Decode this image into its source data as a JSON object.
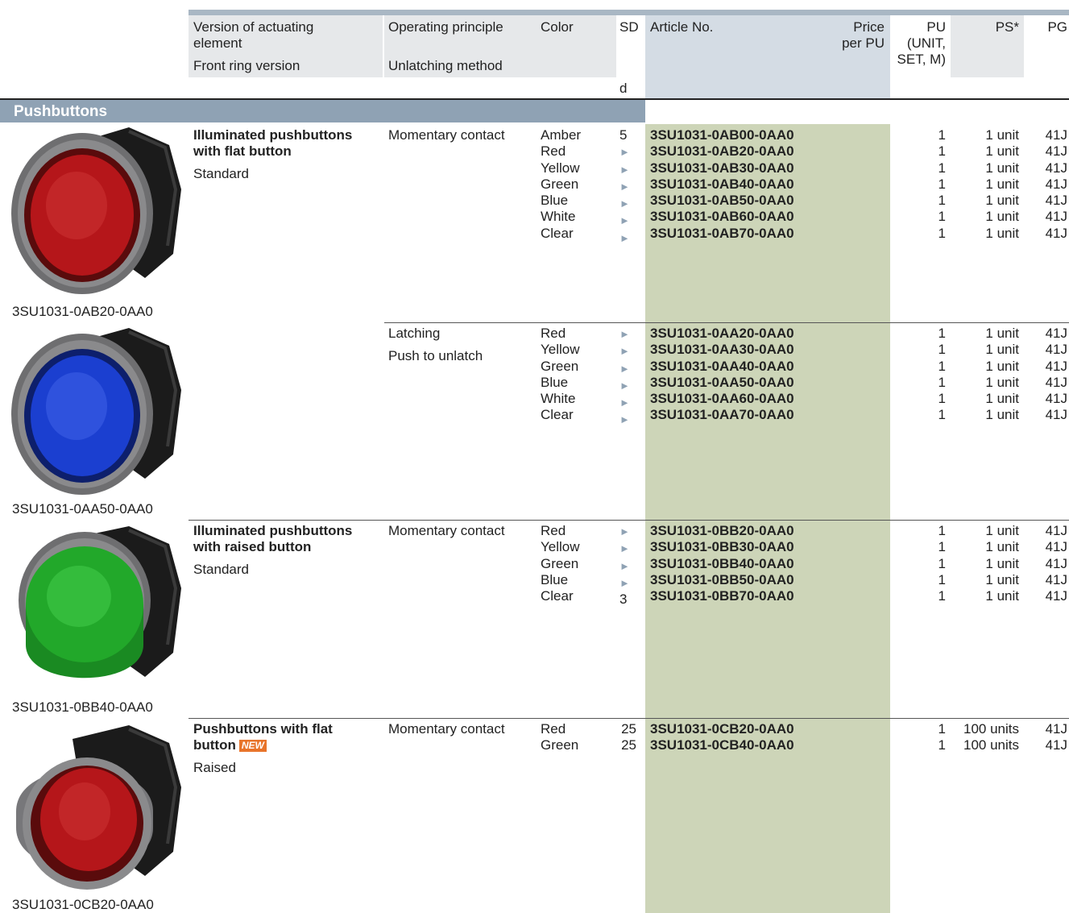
{
  "header": {
    "version": "Version of actuating element",
    "front_ring": "Front ring version",
    "principle": "Operating principle",
    "unlatching": "Unlatching method",
    "color": "Color",
    "sd": "SD",
    "sd_unit": "d",
    "article": "Article No.",
    "price": "Price per PU",
    "pu": "PU (UNIT, SET, M)",
    "ps": "PS*",
    "pg": "PG"
  },
  "section_title": "Pushbuttons",
  "groups": [
    {
      "image_caption": "3SU1031-0AB20-0AA0",
      "version": "Illuminated pushbuttons with flat button",
      "is_new": false,
      "front_ring": "Standard",
      "principle": "Momentary contact",
      "unlatch": "",
      "colors": "Amber\nRed\nYellow\nGreen\nBlue\nWhite\nClear",
      "sd": "5\n►\n►\n►\n►\n►\n►",
      "articles": "3SU1031-0AB00-0AA0\n3SU1031-0AB20-0AA0\n3SU1031-0AB30-0AA0\n3SU1031-0AB40-0AA0\n3SU1031-0AB50-0AA0\n3SU1031-0AB60-0AA0\n3SU1031-0AB70-0AA0",
      "pu": "1\n1\n1\n1\n1\n1\n1",
      "ps": "1 unit\n1 unit\n1 unit\n1 unit\n1 unit\n1 unit\n1 unit",
      "pg": "41J\n41J\n41J\n41J\n41J\n41J\n41J"
    },
    {
      "image_caption": "3SU1031-0AA50-0AA0",
      "version": "",
      "is_new": false,
      "front_ring": "",
      "principle": "Latching",
      "unlatch": "Push to unlatch",
      "colors": "Red\nYellow\nGreen\nBlue\nWhite\nClear",
      "sd": "►\n►\n►\n►\n►\n►",
      "articles": "3SU1031-0AA20-0AA0\n3SU1031-0AA30-0AA0\n3SU1031-0AA40-0AA0\n3SU1031-0AA50-0AA0\n3SU1031-0AA60-0AA0\n3SU1031-0AA70-0AA0",
      "pu": "1\n1\n1\n1\n1\n1",
      "ps": "1 unit\n1 unit\n1 unit\n1 unit\n1 unit\n1 unit",
      "pg": "41J\n41J\n41J\n41J\n41J\n41J"
    },
    {
      "image_caption": "3SU1031-0BB40-0AA0",
      "version": "Illuminated pushbuttons with raised button",
      "is_new": false,
      "front_ring": "Standard",
      "principle": "Momentary contact",
      "unlatch": "",
      "colors": "Red\nYellow\nGreen\nBlue\nClear",
      "sd": "►\n►\n►\n►\n3",
      "articles": "3SU1031-0BB20-0AA0\n3SU1031-0BB30-0AA0\n3SU1031-0BB40-0AA0\n3SU1031-0BB50-0AA0\n3SU1031-0BB70-0AA0",
      "pu": "1\n1\n1\n1\n1",
      "ps": "1 unit\n1 unit\n1 unit\n1 unit\n1 unit",
      "pg": "41J\n41J\n41J\n41J\n41J"
    },
    {
      "image_caption": "3SU1031-0CB20-0AA0",
      "version": "Pushbuttons with flat button",
      "is_new": true,
      "new_label": "NEW",
      "front_ring": "Raised",
      "principle": "Momentary contact",
      "unlatch": "",
      "colors": "Red\nGreen",
      "sd": "25\n25",
      "articles": "3SU1031-0CB20-0AA0\n3SU1031-0CB40-0AA0",
      "pu": "1\n1",
      "ps": "100 units\n100 units",
      "pg": "41J\n41J"
    }
  ],
  "colors": {
    "header_bar": "#a9b7c4",
    "section_bar": "#8fa2b4",
    "article_column": "#cdd5b8",
    "header_shade": "#e6e8ea",
    "new_badge": "#e8742a",
    "button_colors": [
      "#b5161a",
      "#1b3fd0",
      "#22a82a",
      "#b5161a"
    ]
  },
  "icons": [
    "pushbutton-red-icon",
    "pushbutton-blue-icon",
    "pushbutton-green-icon",
    "pushbutton-red-raised-icon"
  ]
}
